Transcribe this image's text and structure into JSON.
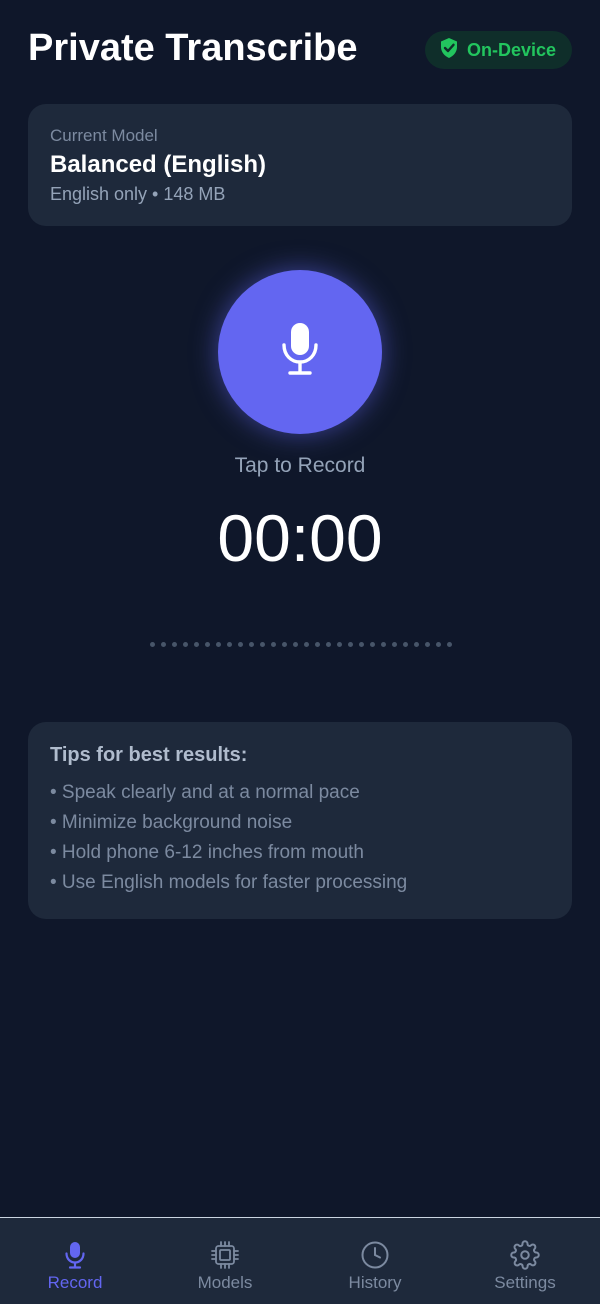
{
  "header": {
    "title": "Private Transcribe",
    "badge": {
      "label": "On-Device",
      "icon": "shield-check-icon"
    }
  },
  "model": {
    "caption": "Current Model",
    "name": "Balanced (English)",
    "details": "English only • 148 MB"
  },
  "recorder": {
    "button_icon": "microphone-icon",
    "hint": "Tap to Record",
    "timer": "00:00",
    "waveform_dots": 28
  },
  "tips": {
    "title": "Tips for best results:",
    "items": [
      "• Speak clearly and at a normal pace",
      "• Minimize background noise",
      "• Hold phone 6-12 inches from mouth",
      "• Use English models for faster processing"
    ]
  },
  "tabs": [
    {
      "label": "Record",
      "icon": "microphone-icon",
      "active": true
    },
    {
      "label": "Models",
      "icon": "chip-icon",
      "active": false
    },
    {
      "label": "History",
      "icon": "clock-icon",
      "active": false
    },
    {
      "label": "Settings",
      "icon": "gear-icon",
      "active": false
    }
  ],
  "colors": {
    "background": "#0f172a",
    "card": "#1e293b",
    "accent": "#6366f1",
    "success": "#22c55e",
    "muted": "#94a3b8"
  }
}
